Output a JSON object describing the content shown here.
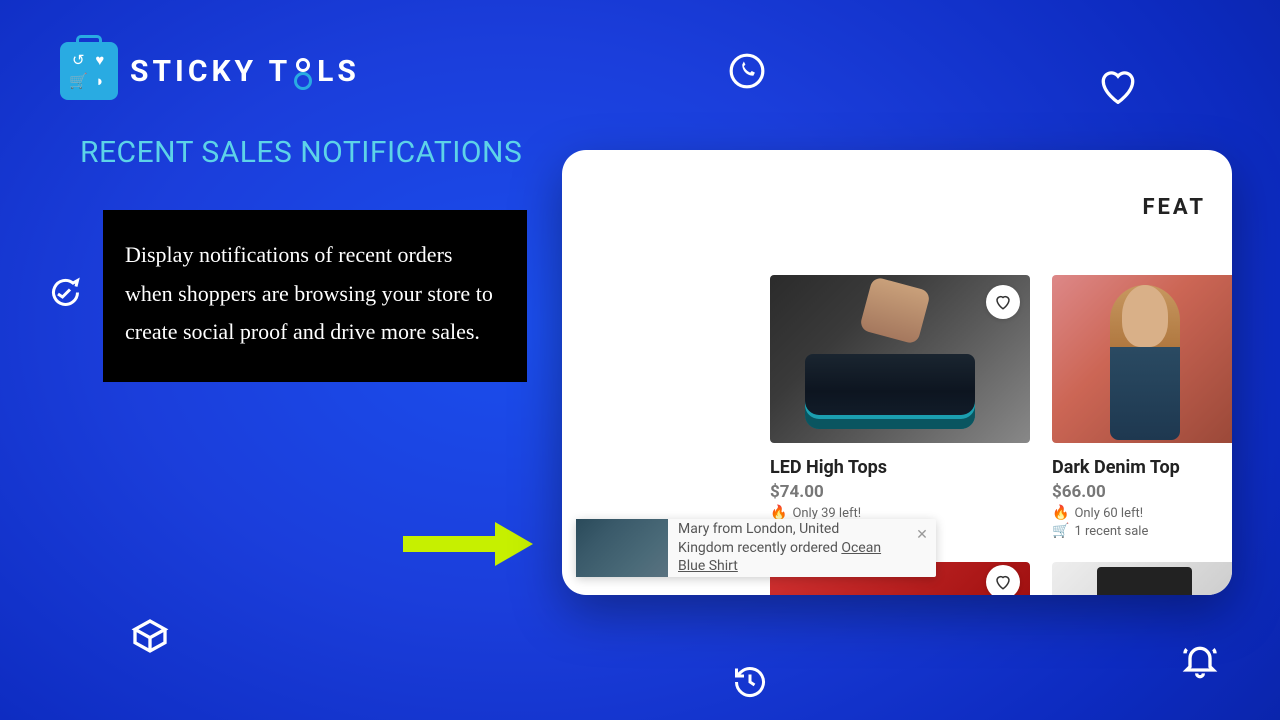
{
  "brand_name": "STICKY TOOLS",
  "heading": "RECENT SALES NOTIFICATIONS",
  "description": "Display notifications of recent orders when shoppers are browsing your store to create social proof and drive more sales.",
  "mockup": {
    "header_partial": "FEAT",
    "products": [
      {
        "name": "LED High Tops",
        "price": "$74.00",
        "stock_text": "Only 39 left!"
      },
      {
        "name": "Dark Denim Top",
        "price": "$66.00",
        "stock_text": "Only 60 left!",
        "recent_sale": "1 recent sale"
      }
    ],
    "notification": {
      "text_prefix": "Mary from London, United Kingdom recently ordered ",
      "product": "Ocean Blue Shirt"
    }
  }
}
